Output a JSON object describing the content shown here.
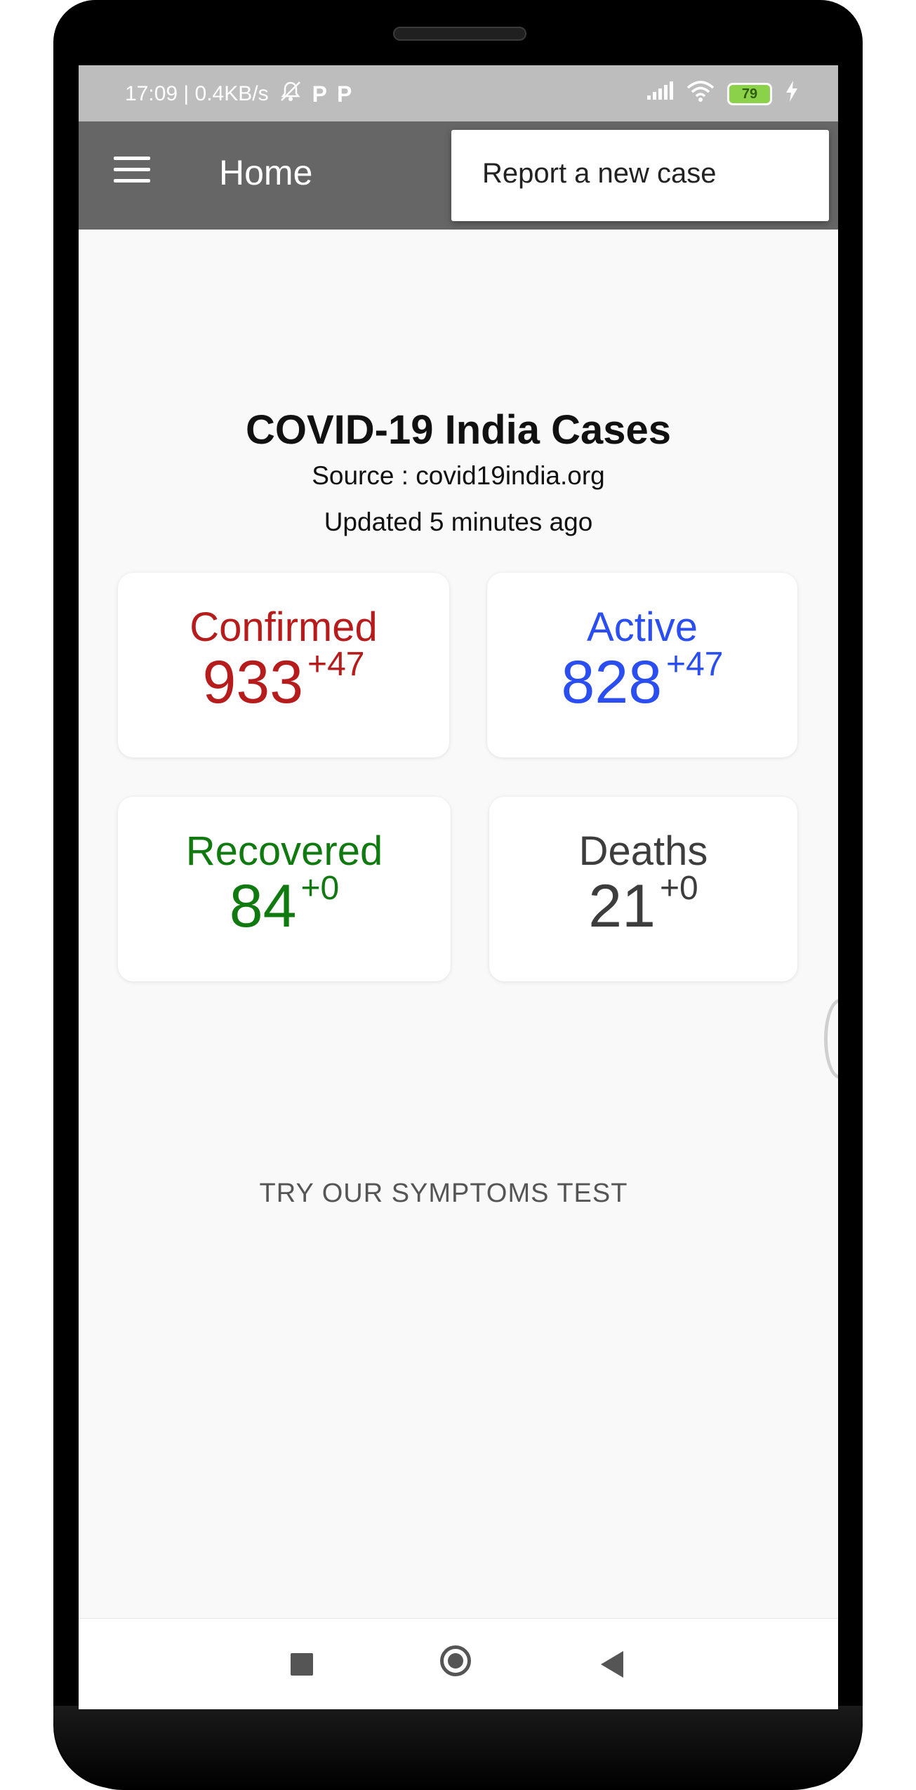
{
  "status_bar": {
    "time_speed": "17:09 | 0.4KB/s",
    "icons": [
      "mute-bell-icon",
      "p-badge-icon",
      "p-badge-icon",
      "signal-icon",
      "wifi-icon",
      "battery-icon",
      "charging-bolt-icon"
    ],
    "p_badge_1": "P",
    "p_badge_2": "P",
    "battery_level": "79"
  },
  "app_bar": {
    "title": "Home",
    "menu_icon": "hamburger-menu-icon"
  },
  "overflow_menu": {
    "items": [
      {
        "label": "Report a new case"
      }
    ]
  },
  "main": {
    "title": "COVID-19 India Cases",
    "source": "Source : covid19india.org",
    "updated": "Updated  5 minutes ago",
    "stats": {
      "confirmed": {
        "label": "Confirmed",
        "value": "933",
        "delta": "+47",
        "color": "#b71c1c"
      },
      "active": {
        "label": "Active",
        "value": "828",
        "delta": "+47",
        "color": "#2b4ef0"
      },
      "recovered": {
        "label": "Recovered",
        "value": "84",
        "delta": "+0",
        "color": "#107a10"
      },
      "deaths": {
        "label": "Deaths",
        "value": "21",
        "delta": "+0",
        "color": "#3d3d3d"
      }
    },
    "symptoms_button": "TRY OUR SYMPTOMS TEST"
  },
  "nav_bar": {
    "icons": [
      "recents-square-icon",
      "home-circle-icon",
      "back-triangle-icon"
    ]
  }
}
